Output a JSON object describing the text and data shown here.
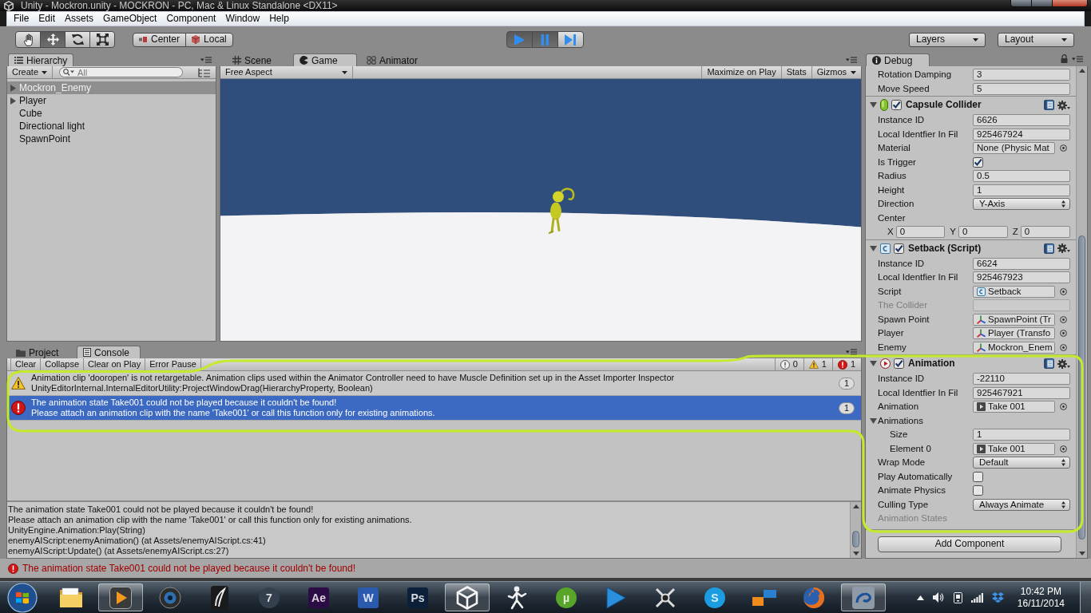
{
  "window": {
    "title": "Unity - Mockron.unity - MOCKRON - PC, Mac & Linux Standalone <DX11>"
  },
  "menu": [
    "File",
    "Edit",
    "Assets",
    "GameObject",
    "Component",
    "Window",
    "Help"
  ],
  "toolbar": {
    "tools": [
      {
        "kind": "hand",
        "selected": false
      },
      {
        "kind": "move",
        "selected": true
      },
      {
        "kind": "rotate",
        "selected": false
      },
      {
        "kind": "scale",
        "selected": false
      }
    ],
    "handles": [
      {
        "kind": "pivot",
        "label": "Center"
      },
      {
        "kind": "space",
        "label": "Local"
      }
    ],
    "playback": [
      {
        "kind": "play",
        "on": true
      },
      {
        "kind": "pause",
        "on": true
      },
      {
        "kind": "step",
        "on": false
      }
    ],
    "dropdowns": [
      "Layers",
      "Layout"
    ]
  },
  "hierarchy": {
    "tabs": [
      {
        "kind": "hierarchy",
        "label": "Hierarchy",
        "selected": true
      }
    ],
    "create": "Create",
    "search": {
      "placeholder": "All"
    },
    "items": [
      {
        "label": "Mockron_Enemy",
        "expandable": true,
        "selected": true
      },
      {
        "label": "Player",
        "expandable": true,
        "selected": false
      },
      {
        "label": "Cube",
        "expandable": false,
        "selected": false
      },
      {
        "label": "Directional light",
        "expandable": false,
        "selected": false
      },
      {
        "label": "SpawnPoint",
        "expandable": false,
        "selected": false
      }
    ]
  },
  "game": {
    "tabs": [
      {
        "kind": "scene",
        "label": "Scene",
        "selected": false
      },
      {
        "kind": "game",
        "label": "Game",
        "selected": true
      },
      {
        "kind": "animator",
        "label": "Animator",
        "selected": false
      }
    ],
    "aspect": "Free Aspect",
    "buttons": [
      {
        "kind": "toggle",
        "label": "Maximize on Play"
      },
      {
        "kind": "toggle",
        "label": "Stats"
      },
      {
        "kind": "menu",
        "label": "Gizmos"
      }
    ]
  },
  "inspector": {
    "tabs": [
      {
        "kind": "debug",
        "label": "Debug",
        "selected": true
      }
    ],
    "rows": [
      {
        "kind": "field",
        "label": "Rotation Damping",
        "value": "3"
      },
      {
        "kind": "field",
        "label": "Move Speed",
        "value": "5"
      },
      {
        "kind": "collider_header",
        "label": "Capsule Collider",
        "enabled": true,
        "expanded": true
      },
      {
        "kind": "field",
        "label": "Instance ID",
        "value": "6626"
      },
      {
        "kind": "field",
        "label": "Local Identfier In Fil",
        "value": "925467924"
      },
      {
        "kind": "object",
        "label": "Material",
        "value": "None (Physic Mat"
      },
      {
        "kind": "checkbox",
        "label": "Is Trigger",
        "checked": true
      },
      {
        "kind": "field",
        "label": "Radius",
        "value": "0.5"
      },
      {
        "kind": "field",
        "label": "Height",
        "value": "1"
      },
      {
        "kind": "dropdown",
        "label": "Direction",
        "value": "Y-Axis"
      },
      {
        "kind": "label",
        "label": "Center"
      },
      {
        "kind": "vector",
        "axes": [
          {
            "label": "X",
            "value": "0"
          },
          {
            "label": "Y",
            "value": "0"
          },
          {
            "label": "Z",
            "value": "0"
          }
        ]
      },
      {
        "kind": "script_header",
        "label": "Setback (Script)",
        "enabled": true,
        "expanded": true
      },
      {
        "kind": "field",
        "label": "Instance ID",
        "value": "6624"
      },
      {
        "kind": "field",
        "label": "Local Identfier In Fil",
        "value": "925467923"
      },
      {
        "kind": "script_object",
        "label": "Script",
        "value": "Setback"
      },
      {
        "kind": "disabled_field",
        "label": "The Collider"
      },
      {
        "kind": "transform_object",
        "label": "Spawn Point",
        "value": "SpawnPoint (Tr"
      },
      {
        "kind": "transform_object",
        "label": "Player",
        "value": "Player (Transfo"
      },
      {
        "kind": "transform_object",
        "label": "Enemy",
        "value": "Mockron_Enem"
      },
      {
        "kind": "animation_header",
        "label": "Animation",
        "enabled": true,
        "expanded": true
      },
      {
        "kind": "field",
        "label": "Instance ID",
        "value": "-22110"
      },
      {
        "kind": "field",
        "label": "Local Identfier In Fil",
        "value": "925467921"
      },
      {
        "kind": "clip_object",
        "label": "Animation",
        "value": "Take 001"
      },
      {
        "kind": "foldout",
        "label": "Animations",
        "expanded": true,
        "children": [
          {
            "kind": "field",
            "label": "Size",
            "value": "1"
          },
          {
            "kind": "clip_object",
            "label": "Element 0",
            "value": "Take 001"
          }
        ]
      },
      {
        "kind": "dropdown",
        "label": "Wrap Mode",
        "value": "Default"
      },
      {
        "kind": "checkbox",
        "label": "Play Automatically",
        "checked": false
      },
      {
        "kind": "checkbox",
        "label": "Animate Physics",
        "checked": false
      },
      {
        "kind": "dropdown",
        "label": "Culling Type",
        "value": "Always Animate"
      },
      {
        "kind": "disabled_label",
        "label": "Animation States"
      }
    ],
    "add_button": "Add Component"
  },
  "console": {
    "tabs": [
      {
        "kind": "project",
        "label": "Project",
        "selected": false
      },
      {
        "kind": "console",
        "label": "Console",
        "selected": true
      }
    ],
    "buttons": [
      "Clear",
      "Collapse",
      "Clear on Play",
      "Error Pause"
    ],
    "counters": [
      {
        "kind": "info",
        "count": "0"
      },
      {
        "kind": "warning",
        "count": "1"
      },
      {
        "kind": "error",
        "count": "1"
      }
    ],
    "entries": [
      {
        "kind": "warning",
        "lines": [
          "Animation clip 'dooropen' is not retargetable. Animation clips used within the Animator Controller need to have Muscle Definition set up in the Asset Importer Inspector",
          "UnityEditorInternal.InternalEditorUtility:ProjectWindowDrag(HierarchyProperty, Boolean)"
        ],
        "count": "1",
        "selected": false
      },
      {
        "kind": "error",
        "lines": [
          "The animation state Take001 could not be played because it couldn't be found!",
          "Please attach an animation clip with the name 'Take001' or call this function only for existing animations."
        ],
        "count": "1",
        "selected": true
      }
    ],
    "details": [
      "The animation state Take001 could not be played because it couldn't be found!",
      "Please attach an animation clip with the name 'Take001' or call this function only for existing animations.",
      "UnityEngine.Animation:Play(String)",
      "enemyAIScript:enemyAnimation() (at Assets/enemyAIScript.cs:41)",
      "enemyAIScript:Update() (at Assets/enemyAIScript.cs:27)"
    ]
  },
  "status_bar": {
    "kind": "error",
    "text": "The animation state Take001 could not be played because it couldn't be found!"
  },
  "annotation": {
    "kind": "freehand_loop"
  },
  "taskbar": {
    "apps": [
      {
        "kind": "folder",
        "running": false
      },
      {
        "kind": "media_player",
        "running": true
      },
      {
        "kind": "webcam",
        "running": false
      },
      {
        "kind": "brush",
        "running": false
      },
      {
        "kind": "round_tile",
        "glyph": "7",
        "color": "#34404d",
        "running": false
      },
      {
        "kind": "tile",
        "glyph": "Ae",
        "color": "#2c0c45",
        "running": false
      },
      {
        "kind": "tile",
        "glyph": "W",
        "color": "#2a5aae",
        "running": false
      },
      {
        "kind": "tile",
        "glyph": "Ps",
        "color": "#0c2039",
        "running": false
      },
      {
        "kind": "unity",
        "running": true
      },
      {
        "kind": "figure",
        "running": false
      },
      {
        "kind": "round_tile",
        "glyph": "µ",
        "color": "#58a52a",
        "running": false
      },
      {
        "kind": "play",
        "running": false
      },
      {
        "kind": "cross",
        "running": false
      },
      {
        "kind": "round_tile",
        "glyph": "S",
        "color": "#1c9de2",
        "running": false
      },
      {
        "kind": "blocks",
        "running": false
      },
      {
        "kind": "firefox",
        "running": false
      },
      {
        "kind": "swirl",
        "running": true
      }
    ],
    "tray": [
      {
        "kind": "chevron"
      },
      {
        "kind": "speaker"
      },
      {
        "kind": "device"
      },
      {
        "kind": "signal"
      },
      {
        "kind": "dropbox"
      }
    ],
    "time": "10:42 PM",
    "date": "16/11/2014"
  }
}
